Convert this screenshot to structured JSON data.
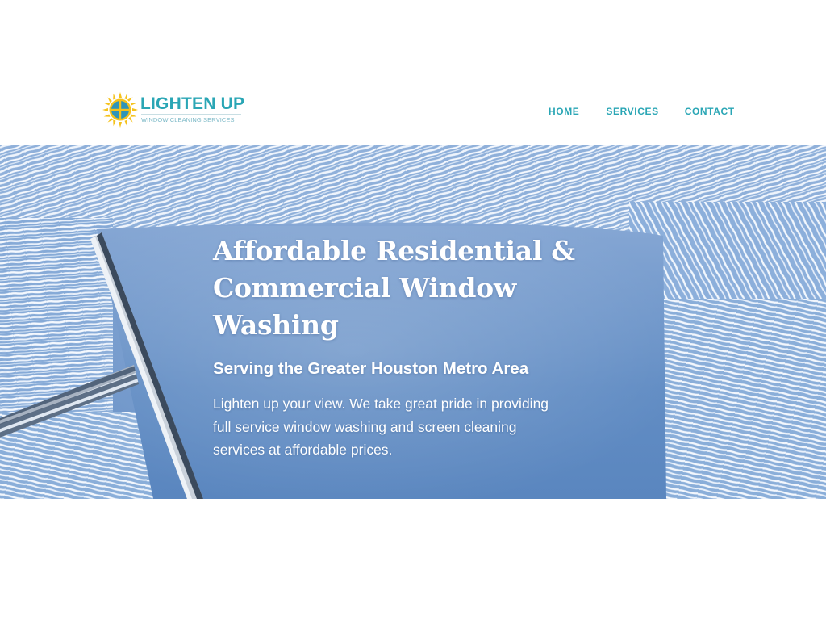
{
  "brand": {
    "name": "LIGHTEN UP",
    "tagline": "WINDOW CLEANING SERVICES",
    "primary_color": "#2aa6b5",
    "sun_color": "#f5c21b"
  },
  "nav": {
    "items": [
      {
        "label": "HOME"
      },
      {
        "label": "SERVICES"
      },
      {
        "label": "CONTACT"
      }
    ]
  },
  "hero": {
    "title": "Affordable Residential & Commercial Window Washing",
    "subtitle": "Serving the Greater Houston Metro Area",
    "body": "Lighten up your view. We take great pride in providing full service window washing and screen cleaning services at affordable prices.",
    "background": "squeegee-soapy-window-image"
  }
}
